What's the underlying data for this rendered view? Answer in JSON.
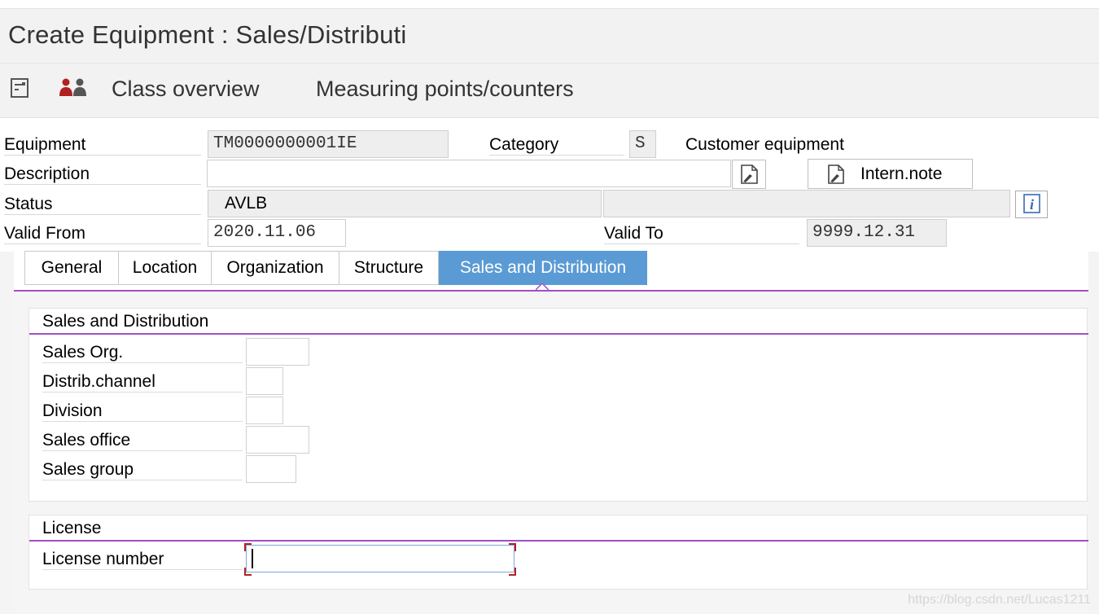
{
  "window": {
    "title": "Create Equipment : Sales/Distributi"
  },
  "toolbar": {
    "icon_1": "document-list-icon",
    "icon_2": "partners-icon",
    "class_overview_label": "Class overview",
    "measuring_points_label": "Measuring points/counters"
  },
  "header": {
    "equipment_label": "Equipment",
    "equipment_value": "TM0000000001IE",
    "category_label": "Category",
    "category_value": "S",
    "category_text": "Customer equipment",
    "description_label": "Description",
    "description_value": "",
    "intern_note_label": "Intern.note",
    "status_label": "Status",
    "status_value": "AVLB",
    "status_extra_value": "",
    "valid_from_label": "Valid From",
    "valid_from_value": "2020.11.06",
    "valid_to_label": "Valid To",
    "valid_to_value": "9999.12.31"
  },
  "tabs": [
    {
      "label": "General",
      "active": false
    },
    {
      "label": "Location",
      "active": false
    },
    {
      "label": "Organization",
      "active": false
    },
    {
      "label": "Structure",
      "active": false
    },
    {
      "label": "Sales and Distribution",
      "active": true
    }
  ],
  "sales_group": {
    "title": "Sales and Distribution",
    "fields": [
      {
        "label": "Sales Org.",
        "value": ""
      },
      {
        "label": "Distrib.channel",
        "value": ""
      },
      {
        "label": "Division",
        "value": ""
      },
      {
        "label": "Sales office",
        "value": ""
      },
      {
        "label": "Sales group",
        "value": ""
      }
    ]
  },
  "license_group": {
    "title": "License",
    "license_number_label": "License number",
    "license_number_value": ""
  },
  "watermark": "https://blog.csdn.net/Lucas1211",
  "colors": {
    "accent_line": "#a34fc4",
    "active_tab": "#5b9bd5",
    "required_marker": "#b22222"
  }
}
